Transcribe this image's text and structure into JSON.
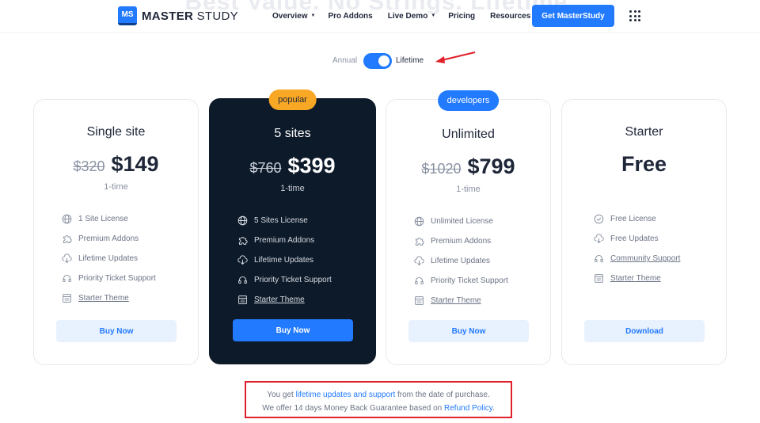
{
  "header": {
    "ghost_title": "Best Value. No Strings. Lifetime.",
    "logo_mark": "MS",
    "logo_bold": "MASTER",
    "logo_light": " STUDY",
    "nav": [
      {
        "label": "Overview",
        "has_caret": true
      },
      {
        "label": "Pro Addons",
        "has_caret": false
      },
      {
        "label": "Live Demo",
        "has_caret": true
      },
      {
        "label": "Pricing",
        "has_caret": false
      },
      {
        "label": "Resources",
        "has_caret": true
      }
    ],
    "cta_label": "Get MasterStudy"
  },
  "billing_toggle": {
    "left_label": "Annual",
    "right_label": "Lifetime",
    "selected": "Lifetime"
  },
  "plans": [
    {
      "badge": "",
      "name": "Single site",
      "old_price": "$320",
      "price": "$149",
      "period": "1-time",
      "features": [
        {
          "icon": "globe-icon",
          "text": "1 Site License",
          "link": false
        },
        {
          "icon": "puzzle-icon",
          "text": "Premium Addons",
          "link": false
        },
        {
          "icon": "cloud-download-icon",
          "text": "Lifetime Updates",
          "link": false
        },
        {
          "icon": "headset-icon",
          "text": "Priority Ticket Support",
          "link": false
        },
        {
          "icon": "theme-icon",
          "text": "Starter Theme",
          "link": true
        }
      ],
      "button": "Buy Now"
    },
    {
      "badge": "popular",
      "name": "5 sites",
      "old_price": "$760",
      "price": "$399",
      "period": "1-time",
      "features": [
        {
          "icon": "globe-icon",
          "text": "5 Sites License",
          "link": false
        },
        {
          "icon": "puzzle-icon",
          "text": "Premium Addons",
          "link": false
        },
        {
          "icon": "cloud-download-icon",
          "text": "Lifetime Updates",
          "link": false
        },
        {
          "icon": "headset-icon",
          "text": "Priority Ticket Support",
          "link": false
        },
        {
          "icon": "theme-icon",
          "text": "Starter Theme",
          "link": true
        }
      ],
      "button": "Buy Now"
    },
    {
      "badge": "developers",
      "name": "Unlimited",
      "old_price": "$1020",
      "price": "$799",
      "period": "1-time",
      "features": [
        {
          "icon": "globe-icon",
          "text": "Unlimited License",
          "link": false
        },
        {
          "icon": "puzzle-icon",
          "text": "Premium Addons",
          "link": false
        },
        {
          "icon": "cloud-download-icon",
          "text": "Lifetime Updates",
          "link": false
        },
        {
          "icon": "headset-icon",
          "text": "Priority Ticket Support",
          "link": false
        },
        {
          "icon": "theme-icon",
          "text": "Starter Theme",
          "link": true
        }
      ],
      "button": "Buy Now"
    },
    {
      "badge": "",
      "name": "Starter",
      "old_price": "",
      "price": "Free",
      "period": "",
      "features": [
        {
          "icon": "check-circle-icon",
          "text": "Free License",
          "link": false
        },
        {
          "icon": "cloud-download-icon",
          "text": "Free Updates",
          "link": false
        },
        {
          "icon": "headset-icon",
          "text": "Community Support",
          "link": true
        },
        {
          "icon": "theme-icon",
          "text": "Starter Theme",
          "link": true
        }
      ],
      "button": "Download"
    }
  ],
  "notice": {
    "line1_pre": "You get ",
    "line1_link": "lifetime updates and support",
    "line1_post": " from the date of purchase.",
    "line2_pre": "We offer 14 days Money Back Guarantee based on ",
    "line2_link": "Refund Policy",
    "line2_post": "."
  },
  "colors": {
    "accent": "#227aff",
    "dark_card": "#0d1a29",
    "popular_badge": "#f9a825",
    "annotation_red": "#e0212b"
  }
}
